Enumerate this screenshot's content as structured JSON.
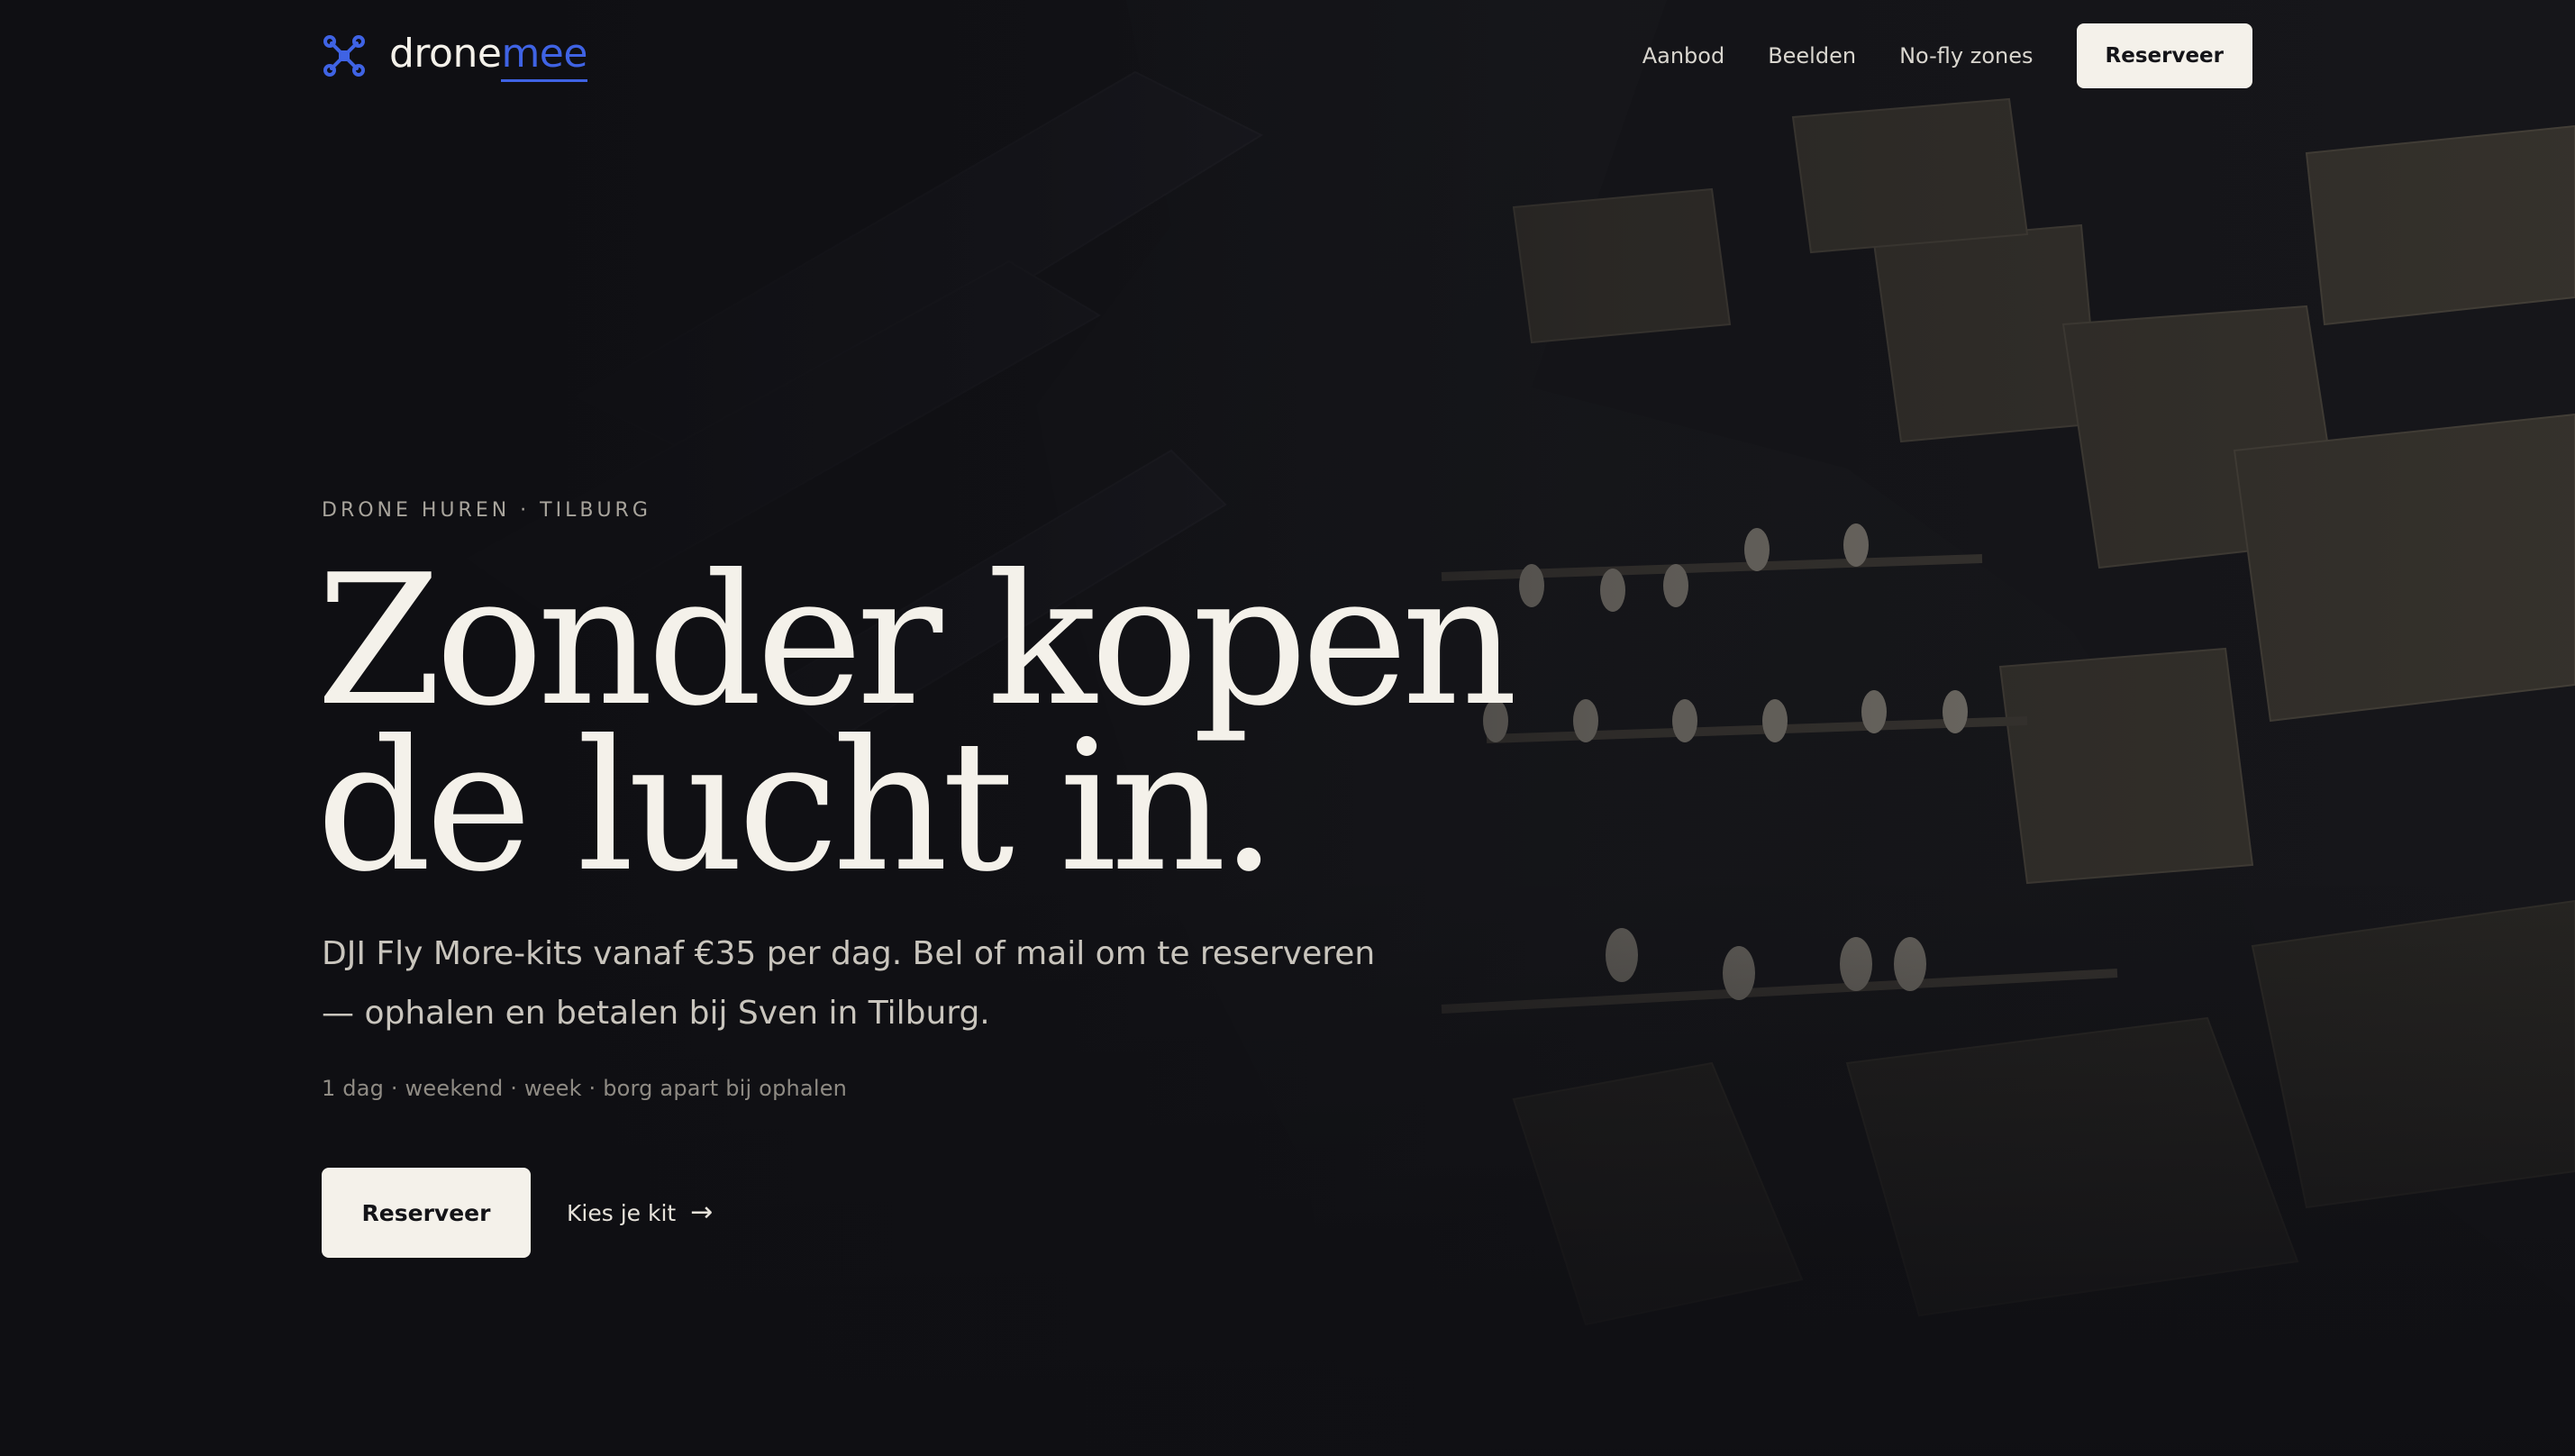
{
  "brand": {
    "name_primary": "drone",
    "name_accent": "mee",
    "icon": "drone-icon",
    "accent_color": "#3f63e4"
  },
  "nav": {
    "links": [
      "Aanbod",
      "Beelden",
      "No-fly zones"
    ],
    "cta_label": "Reserveer"
  },
  "hero": {
    "eyebrow": "DRONE HUREN · TILBURG",
    "headline_line1": "Zonder kopen",
    "headline_line2": "de lucht in.",
    "subtitle": "DJI Fly More-kits vanaf €35 per dag. Bel of mail om te reserveren — ophalen en betalen bij Sven in Tilburg.",
    "meta": "1 dag · weekend · week · borg apart bij ophalen",
    "primary_button": "Reserveer",
    "secondary_link": "Kies je kit",
    "secondary_icon": "arrow-right-icon"
  },
  "colors": {
    "background": "#0f0f13",
    "text": "#f4f1ea",
    "muted": "#8f8b84"
  }
}
